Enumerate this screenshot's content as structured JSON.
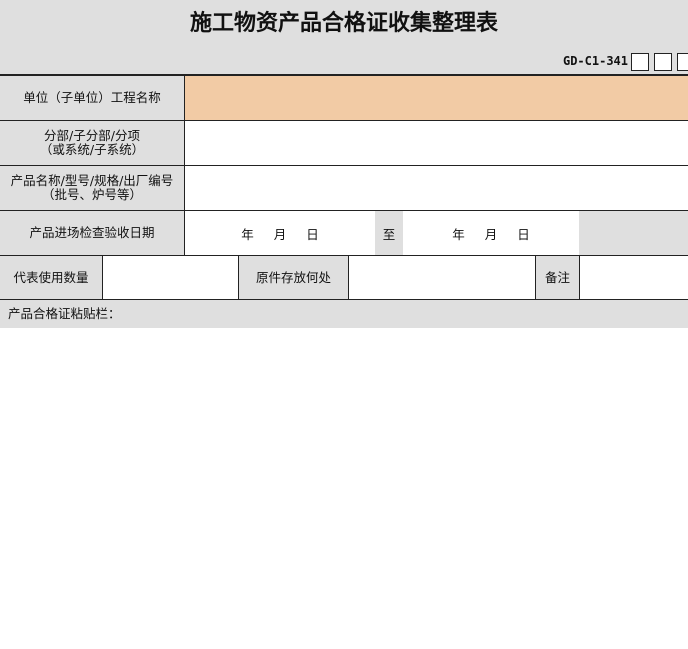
{
  "title": "施工物资产品合格证收集整理表",
  "form_code": "GD-C1-341",
  "rows": {
    "unit_project_label": "单位（子单位）工程名称",
    "subdivision_label_1": "分部/子分部/分项",
    "subdivision_label_2": "（或系统/子系统）",
    "product_label_1": "产品名称/型号/规格/出厂编号",
    "product_label_2": "（批号、炉号等）",
    "inspection_date_label": "产品进场检查验收日期",
    "date_from": {
      "year": "年",
      "month": "月",
      "day": "日"
    },
    "date_separator": "至",
    "date_to": {
      "year": "年",
      "month": "月",
      "day": "日"
    },
    "quantity_label": "代表使用数量",
    "original_location_label": "原件存放何处",
    "remarks_label": "备注"
  },
  "paste_area_label": "产品合格证粘贴栏："
}
